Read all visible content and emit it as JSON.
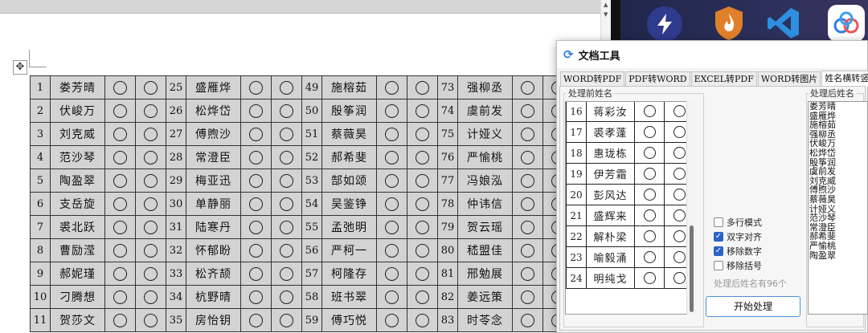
{
  "doc": {
    "rows": [
      {
        "c": [
          [
            "1",
            "娄芳晴"
          ],
          [
            "25",
            "盛雁烨"
          ],
          [
            "49",
            "施榕茹"
          ],
          [
            "73",
            "强柳丞"
          ]
        ]
      },
      {
        "c": [
          [
            "2",
            "伏峻万"
          ],
          [
            "26",
            "松烨岱"
          ],
          [
            "50",
            "殷筝润"
          ],
          [
            "74",
            "虞前发"
          ]
        ]
      },
      {
        "c": [
          [
            "3",
            "刘克威"
          ],
          [
            "27",
            "傅煦沙"
          ],
          [
            "51",
            "蔡薇昊"
          ],
          [
            "75",
            "计娅义"
          ]
        ]
      },
      {
        "c": [
          [
            "4",
            "范沙琴"
          ],
          [
            "28",
            "常澄臣"
          ],
          [
            "52",
            "郝希斐"
          ],
          [
            "76",
            "严愉桃"
          ]
        ]
      },
      {
        "c": [
          [
            "5",
            "陶盈翠"
          ],
          [
            "29",
            "梅亚迅"
          ],
          [
            "53",
            "郜如颂"
          ],
          [
            "77",
            "冯娘泓"
          ]
        ]
      },
      {
        "c": [
          [
            "6",
            "支岳旋"
          ],
          [
            "30",
            "单静丽"
          ],
          [
            "54",
            "吴鉴铮"
          ],
          [
            "78",
            "仲讳信"
          ]
        ]
      },
      {
        "c": [
          [
            "7",
            "裘北跃"
          ],
          [
            "31",
            "陆寒丹"
          ],
          [
            "55",
            "孟弛明"
          ],
          [
            "79",
            "贺云瑶"
          ]
        ]
      },
      {
        "c": [
          [
            "8",
            "曹励滢"
          ],
          [
            "32",
            "怀郁盼"
          ],
          [
            "56",
            "严柯一"
          ],
          [
            "80",
            "嵇盟佳"
          ]
        ]
      },
      {
        "c": [
          [
            "9",
            "郝妮瑾"
          ],
          [
            "33",
            "松齐颉"
          ],
          [
            "57",
            "柯隆存"
          ],
          [
            "81",
            "邢勉展"
          ]
        ]
      },
      {
        "c": [
          [
            "10",
            "刁腾想"
          ],
          [
            "34",
            "杭野晴"
          ],
          [
            "58",
            "班书翠"
          ],
          [
            "82",
            "姜远策"
          ]
        ]
      },
      {
        "c": [
          [
            "11",
            "贺莎文"
          ],
          [
            "35",
            "房怡钥"
          ],
          [
            "59",
            "傅巧悦"
          ],
          [
            "83",
            "时苓念"
          ]
        ]
      }
    ]
  },
  "dialog": {
    "title": "文档工具",
    "tabs": [
      "WORD转PDF",
      "PDF转WORD",
      "EXCEL转PDF",
      "WORD转图片",
      "姓名横转竖列"
    ],
    "before_label": "处理前姓名",
    "after_label": "处理后姓名",
    "before_rows": [
      [
        "16",
        "蒋彩汝"
      ],
      [
        "17",
        "裘孝蓬"
      ],
      [
        "18",
        "惠珑栋"
      ],
      [
        "19",
        "伊芳霜"
      ],
      [
        "20",
        "彭风达"
      ],
      [
        "21",
        "盛辉来"
      ],
      [
        "22",
        "解朴梁"
      ],
      [
        "23",
        "喻毅涌"
      ],
      [
        "24",
        "明纯戈"
      ]
    ],
    "options": [
      {
        "label": "多行模式",
        "checked": false
      },
      {
        "label": "双字对齐",
        "checked": true
      },
      {
        "label": "移除数字",
        "checked": true
      },
      {
        "label": "移除括号",
        "checked": false
      }
    ],
    "count_text": "处理后姓名有96个",
    "start_button": "开始处理",
    "after_names": [
      "娄芳晴",
      "盛雁烨",
      "施榕茹",
      "强柳丞",
      "伏峻万",
      "松烨岱",
      "殷筝润",
      "虞前发",
      "刘克威",
      "傅煦沙",
      "蔡薇昊",
      "计娅义",
      "范沙琴",
      "常澄臣",
      "郝希斐",
      "严愉桃",
      "陶盈翠"
    ]
  },
  "dock": {
    "icons": [
      "lightning-icon",
      "shield-fire-icon",
      "vscode-icon",
      "cloud-app-icon"
    ]
  }
}
